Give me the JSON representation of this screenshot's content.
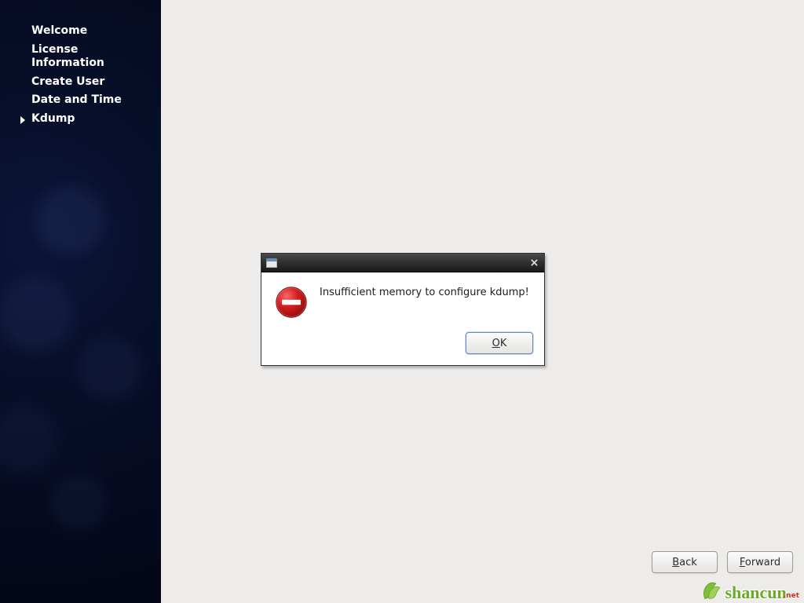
{
  "sidebar": {
    "items": [
      {
        "label": "Welcome"
      },
      {
        "label": "License Information"
      },
      {
        "label": "Create User"
      },
      {
        "label": "Date and Time"
      },
      {
        "label": "Kdump"
      }
    ],
    "current_index": 4
  },
  "footer": {
    "back_label": "Back",
    "forward_label": "Forward"
  },
  "dialog": {
    "message": "Insufficient memory to configure kdump!",
    "ok_label": "OK",
    "icon": "error-icon"
  },
  "watermark": {
    "text": "shancun",
    "sub": ".net"
  }
}
